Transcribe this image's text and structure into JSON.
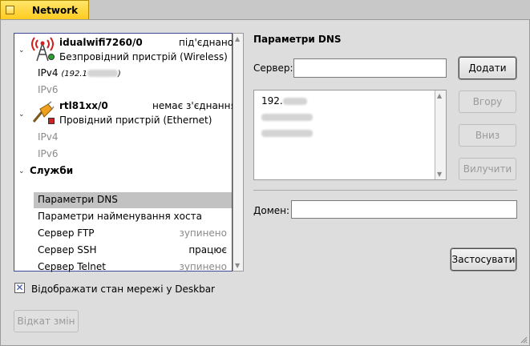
{
  "window": {
    "title": "Network"
  },
  "interfaces": [
    {
      "name": "idualwifi7260/0",
      "status": "під'єднано",
      "description": "Безпровідний пристрій (Wireless)",
      "status_color": "#2aa12a",
      "protocols": [
        {
          "label": "IPv4",
          "address": "(192.1"
        },
        {
          "label": "IPv6"
        }
      ]
    },
    {
      "name": "rtl81xx/0",
      "status": "немає з'єднання",
      "description": "Провідний пристрій (Ethernet)",
      "status_color": "#cc2222",
      "protocols": [
        {
          "label": "IPv4"
        },
        {
          "label": "IPv6"
        }
      ]
    }
  ],
  "services": {
    "header": "Служби",
    "items": [
      {
        "label": "Параметри DNS",
        "status": ""
      },
      {
        "label": "Параметри найменування хоста",
        "status": ""
      },
      {
        "label": "Сервер FTP",
        "status": "зупинено"
      },
      {
        "label": "Сервер SSH",
        "status": "працює"
      },
      {
        "label": "Сервер Telnet",
        "status": "зупинено"
      }
    ]
  },
  "dns": {
    "heading": "Параметри DNS",
    "server_label": "Сервер:",
    "server_value": "",
    "servers": [
      "192."
    ],
    "add": "Додати",
    "up": "Вгору",
    "down": "Вниз",
    "remove": "Вилучити",
    "domain_label": "Домен:",
    "domain_value": "",
    "apply": "Застосувати"
  },
  "show_deskbar": {
    "label": "Відображати стан мережі у Deskbar",
    "checked": true
  },
  "revert": "Відкат змін"
}
